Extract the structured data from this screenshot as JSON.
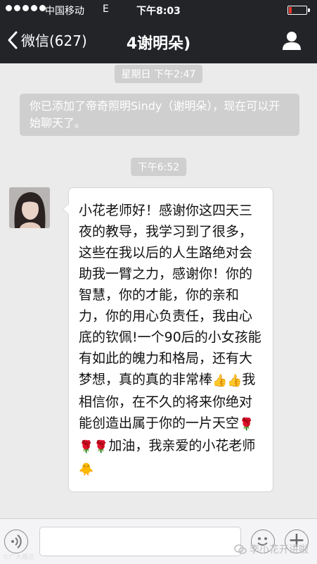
{
  "status": {
    "carrier": "中国移动",
    "network": "E",
    "time": "下午8:03"
  },
  "nav": {
    "back_label": "微信(627)",
    "title": "4谢明朵)"
  },
  "messages": {
    "time1": "星期日 下午2:47",
    "notice": "你已添加了帝奇照明Sindy（谢明朵），现在可以开始聊天了。",
    "time2": "下午6:52",
    "bubble_part1": "小花老师好！感谢你这四天三夜的教导，我学习到了很多，这些在我以后的人生路绝对会助我一臂之力，感谢你！你的智慧，你的才能，你的亲和力，你的用心负责任，我由心底的钦佩!一个90后的小女孩能有如此的魄力和格局，还有大梦想，真的真的非常棒",
    "bubble_part2": "我相信你，在不久的将来你绝对能创造出属于你的一片天空",
    "bubble_part3": "加油，我亲爱的小花老师"
  },
  "icons": {
    "thumb": "thumbs-up-icon",
    "rose": "rose-icon",
    "chick": "chick-icon"
  },
  "watermark": {
    "left": "©广大路达",
    "right": "李小花开讲啦"
  }
}
